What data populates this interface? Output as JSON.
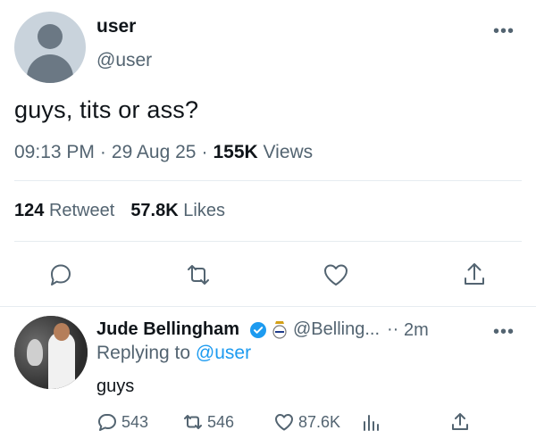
{
  "tweet": {
    "display_name": "user",
    "handle": "@user",
    "more": "•••",
    "text": "guys, tits or ass?",
    "time": "09:13 PM",
    "date": "29 Aug 25",
    "views_count": "155K",
    "views_label": "Views",
    "retweet_count": "124",
    "retweet_label": "Retweet",
    "likes_count": "57.8K",
    "likes_label": "Likes"
  },
  "reply": {
    "display_name": "Jude Bellingham",
    "handle": "@Belling...",
    "dot": "··",
    "time": "2m",
    "more": "•••",
    "replying_prefix": "Replying to",
    "replying_to": "@user",
    "text": "guys",
    "reply_count": "543",
    "retweet_count": "546",
    "like_count": "87.6K"
  },
  "colors": {
    "text": "#0f1419",
    "secondary": "#536471",
    "link": "#1d9bf0",
    "divider": "#e6ecf0"
  }
}
